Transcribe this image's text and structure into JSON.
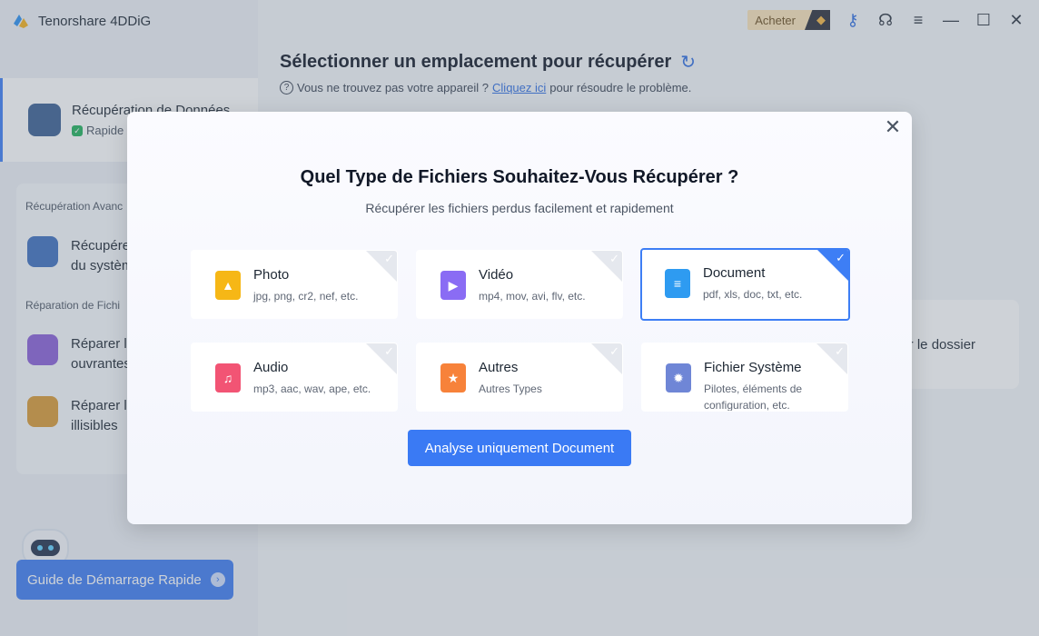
{
  "app": {
    "title": "Tenorshare 4DDiG"
  },
  "topbar": {
    "buy_label": "Acheter"
  },
  "sidebar": {
    "active_item": {
      "title": "Récupération de Données",
      "subtitle": "Rapide"
    },
    "section1_label": "Récupération Avanc",
    "item_system": "Récupére du systèm",
    "section2_label": "Réparation de Fichi",
    "item_repair1": "Réparer le ouvrantes",
    "item_repair2": "Réparer le illisibles",
    "guide_button": "Guide de Démarrage Rapide"
  },
  "main": {
    "title": "Sélectionner un emplacement pour récupérer",
    "help_prefix": "Vous ne trouvez pas votre appareil ?",
    "help_link": "Cliquez ici",
    "help_suffix": "pour résoudre le problème.",
    "card_text": "ner le dossier"
  },
  "modal": {
    "title": "Quel Type de Fichiers Souhaitez-Vous Récupérer ?",
    "subtitle": "Récupérer les fichiers perdus facilement et rapidement",
    "scan_button": "Analyse uniquement Document",
    "file_types": [
      {
        "name": "Photo",
        "desc": "jpg, png, cr2, nef, etc.",
        "selected": false,
        "color": "#f6b716",
        "icon": "image-icon"
      },
      {
        "name": "Vidéo",
        "desc": "mp4, mov, avi, flv, etc.",
        "selected": false,
        "color": "#8a6cf4",
        "icon": "video-icon"
      },
      {
        "name": "Document",
        "desc": "pdf, xls, doc, txt, etc.",
        "selected": true,
        "color": "#2e9bf1",
        "icon": "document-icon"
      },
      {
        "name": "Audio",
        "desc": "mp3, aac, wav, ape, etc.",
        "selected": false,
        "color": "#f25474",
        "icon": "music-icon"
      },
      {
        "name": "Autres",
        "desc": "Autres Types",
        "selected": false,
        "color": "#f7823a",
        "icon": "star-icon"
      },
      {
        "name": "Fichier Système",
        "desc": "Pilotes, éléments de configuration, etc.",
        "selected": false,
        "color": "#6f86d6",
        "icon": "gear-icon"
      }
    ]
  },
  "colors": {
    "accent": "#3d7ef5",
    "button": "#3a7af4"
  }
}
